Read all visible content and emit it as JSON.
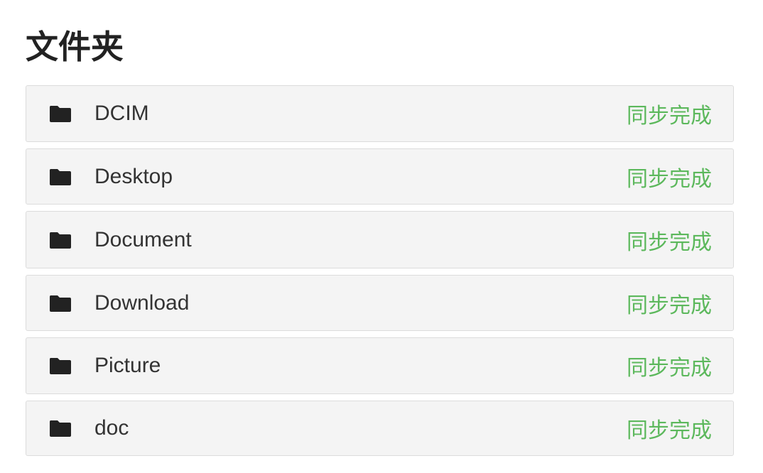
{
  "page": {
    "title": "文件夹"
  },
  "colors": {
    "status_ok": "#5cb85c",
    "row_background": "#f4f4f4",
    "icon": "#222222"
  },
  "folders": [
    {
      "name": "DCIM",
      "status": "同步完成",
      "icon": "folder-icon"
    },
    {
      "name": "Desktop",
      "status": "同步完成",
      "icon": "folder-icon"
    },
    {
      "name": "Document",
      "status": "同步完成",
      "icon": "folder-icon"
    },
    {
      "name": "Download",
      "status": "同步完成",
      "icon": "folder-icon"
    },
    {
      "name": "Picture",
      "status": "同步完成",
      "icon": "folder-icon"
    },
    {
      "name": "doc",
      "status": "同步完成",
      "icon": "folder-icon"
    }
  ]
}
